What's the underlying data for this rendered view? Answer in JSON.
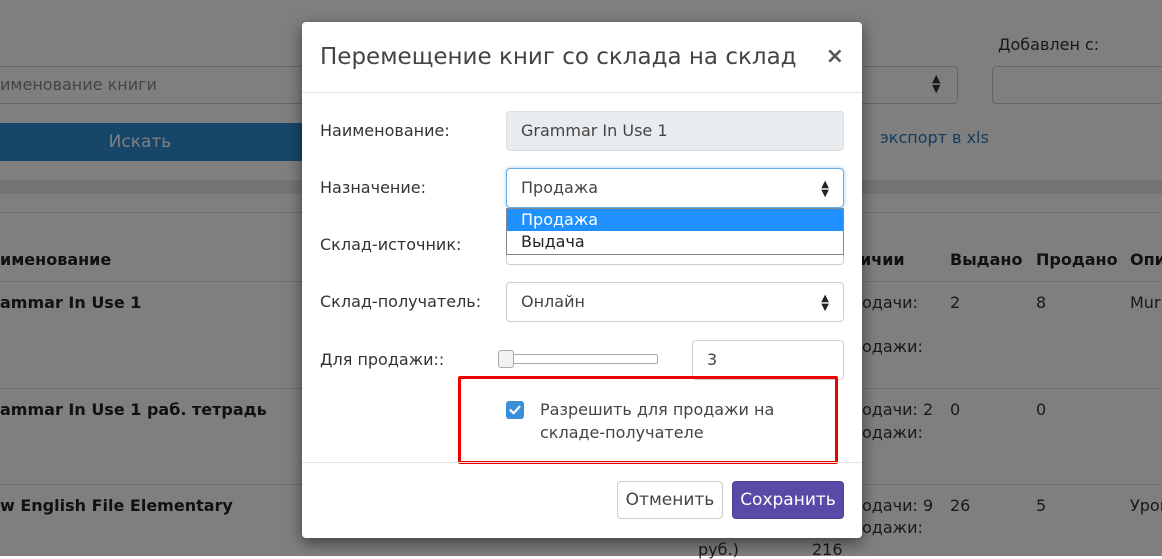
{
  "background": {
    "filter": {
      "added_label": "Добавлен с:",
      "name_placeholder": "именование книги",
      "search_button": "Искать",
      "export_link": "экспорт в xls"
    },
    "table": {
      "headers": [
        "именование",
        "ичии",
        "Выдано",
        "Продано",
        "Опи"
      ],
      "rows": [
        {
          "name": "ammar In Use 1",
          "stock_a": "одачи:",
          "stock_b": "одажи:",
          "issued": "2",
          "sold": "8",
          "desc": "Murp"
        },
        {
          "name": "ammar In Use 1 раб. тетрадь",
          "stock_a": "одачи: 2",
          "stock_b": "одажи:",
          "issued": "0",
          "sold": "0",
          "desc": ""
        },
        {
          "name": "w English File Elementary",
          "stock_a": "одачи: 9",
          "stock_b": "одажи:",
          "issued": "26",
          "sold": "5",
          "desc": "Уров"
        }
      ],
      "footer_a": "руб.)",
      "footer_b": "216"
    }
  },
  "modal": {
    "title": "Перемещение книг со склада на склад",
    "close_label": "×",
    "fields": {
      "name_label": "Наименование:",
      "name_value": "Grammar In Use 1",
      "purpose_label": "Назначение:",
      "purpose_value": "Продажа",
      "purpose_options": [
        "Продажа",
        "Выдача"
      ],
      "source_label": "Склад-источник:",
      "dest_label": "Склад-получатель:",
      "dest_value": "Онлайн",
      "for_sale_label": "Для продажи::",
      "for_sale_value": "3",
      "slider_fraction": 0.0,
      "allow_sale_label": "Разрешить для продажи на складе-получателе",
      "allow_sale_checked": true
    },
    "buttons": {
      "cancel": "Отменить",
      "save": "Сохранить"
    },
    "colors": {
      "save_button": "#5a49a6",
      "checkbox": "#3a8fd9",
      "highlight_box": "#ee0000",
      "dropdown_selected": "#1e90ff"
    }
  }
}
